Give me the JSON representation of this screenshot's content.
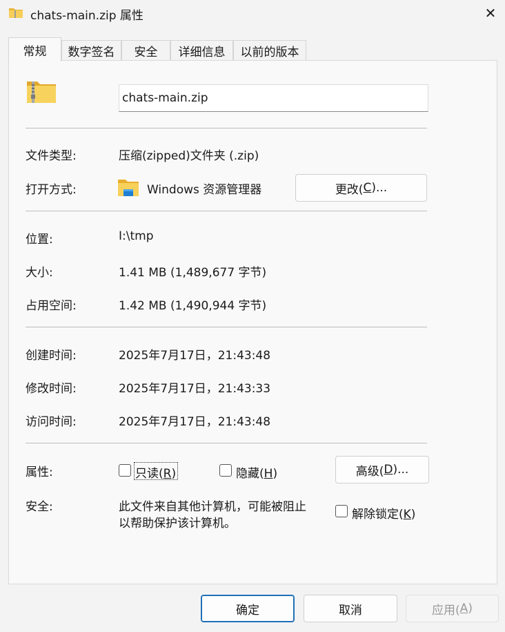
{
  "window": {
    "title": "chats-main.zip 属性",
    "close_glyph": "✕"
  },
  "tabs": [
    {
      "label": "常规",
      "active": true
    },
    {
      "label": "数字签名",
      "active": false
    },
    {
      "label": "安全",
      "active": false
    },
    {
      "label": "详细信息",
      "active": false
    },
    {
      "label": "以前的版本",
      "active": false
    }
  ],
  "file": {
    "icon": "zip-folder-icon",
    "name": "chats-main.zip"
  },
  "type": {
    "label": "文件类型:",
    "value": "压缩(zipped)文件夹 (.zip)"
  },
  "open_with": {
    "label": "打开方式:",
    "app_icon": "explorer-icon",
    "value": "Windows 资源管理器",
    "change_button": {
      "pre": "更改(",
      "key": "C",
      "post": ")..."
    }
  },
  "location": {
    "label": "位置:",
    "value": "I:\\tmp"
  },
  "size": {
    "label": "大小:",
    "value": "1.41 MB (1,489,677 字节)"
  },
  "size_on_disk": {
    "label": "占用空间:",
    "value": "1.42 MB (1,490,944 字节)"
  },
  "created": {
    "label": "创建时间:",
    "value": "2025年7月17日，21:43:48"
  },
  "modified": {
    "label": "修改时间:",
    "value": "2025年7月17日，21:43:33"
  },
  "accessed": {
    "label": "访问时间:",
    "value": "2025年7月17日，21:43:48"
  },
  "attributes": {
    "label": "属性:",
    "readonly": {
      "pre": "只读(",
      "key": "R",
      "post": ")",
      "checked": false
    },
    "hidden": {
      "pre": "隐藏(",
      "key": "H",
      "post": ")",
      "checked": false
    },
    "advanced_button": {
      "pre": "高级(",
      "key": "D",
      "post": ")..."
    }
  },
  "security": {
    "label": "安全:",
    "line1": "此文件来自其他计算机，可能被阻止",
    "line2": "以帮助保护该计算机。",
    "unblock": {
      "pre": "解除锁定(",
      "key": "K",
      "post": ")",
      "checked": false
    }
  },
  "footer": {
    "ok": "确定",
    "cancel": "取消",
    "apply": {
      "pre": "应用(",
      "key": "A",
      "post": ")"
    }
  },
  "colors": {
    "folder_yellow": "#f4c542",
    "accent_blue": "#1f6fb8"
  }
}
